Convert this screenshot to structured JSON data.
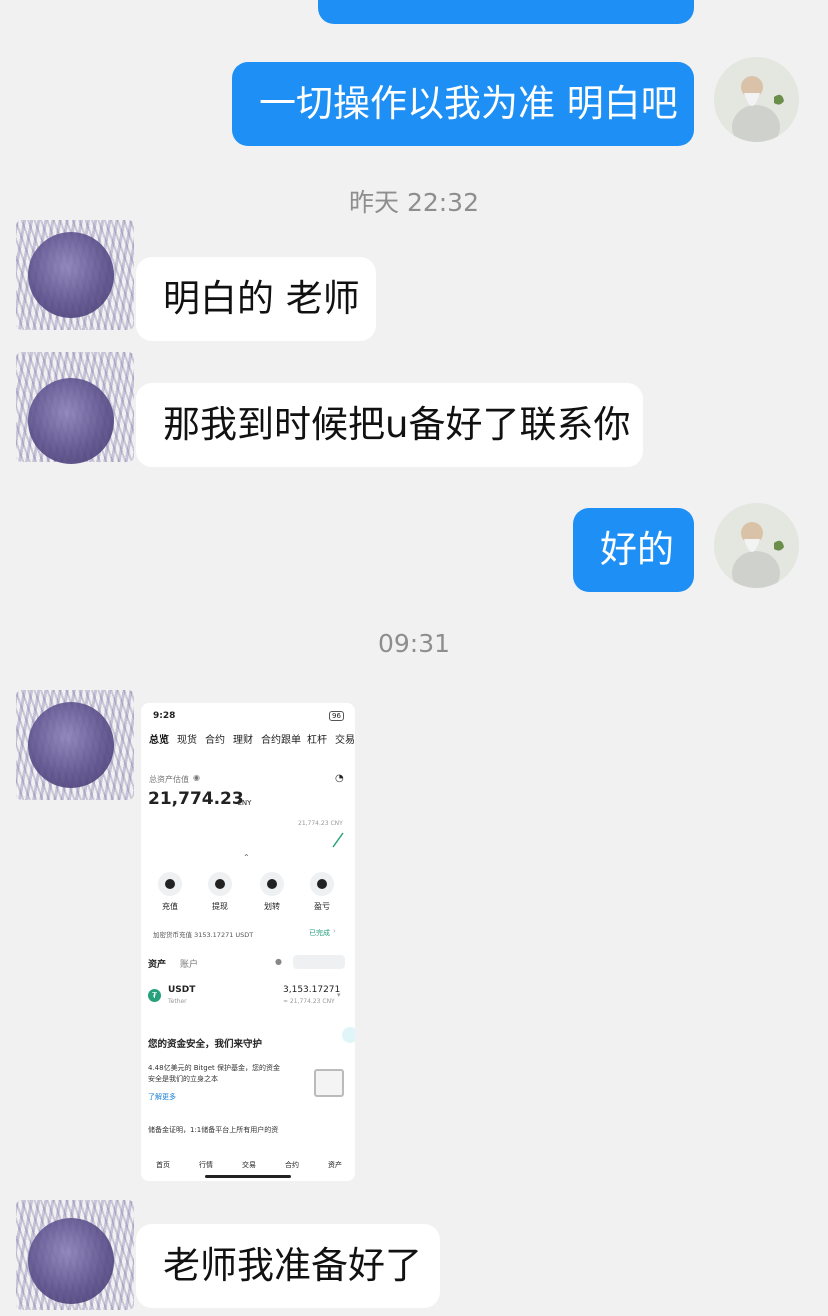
{
  "messages": {
    "m1": "一切操作以我为准 明白吧",
    "ts1": "昨天 22:32",
    "m2": "明白的 老师",
    "m3": "那我到时候把u备好了联系你",
    "m4": "好的",
    "ts2": "09:31",
    "m6": "老师我准备好了"
  },
  "screenshot": {
    "status_time": "9:28",
    "status_right": "96",
    "tabs": [
      "总览",
      "现货",
      "合约",
      "理财",
      "合约跟单",
      "杠杆",
      "交易"
    ],
    "total_label": "总资产估值",
    "total_value": "21,774.23",
    "total_currency": "CNY",
    "sub_value": "21,774.23 CNY",
    "actions": [
      "充值",
      "提现",
      "划转",
      "盈亏"
    ],
    "deposit_note": "加密货币充值 3153.17271 USDT",
    "deposit_status": "已完成",
    "asset_tabs": [
      "资产",
      "账户"
    ],
    "coin_name": "USDT",
    "coin_sub": "Tether",
    "coin_amount": "3,153.17271",
    "coin_cny": "≈ 21,774.23 CNY",
    "security_title": "您的资金安全，我们来守护",
    "security_text_1": "4.48亿美元的 Bitget 保护基金，您的资金",
    "security_text_2": "安全是我们的立身之本",
    "learn_more": "了解更多",
    "reserve_text": "储备金证明，1:1储备平台上所有用户的资",
    "bottom_nav": [
      "首页",
      "行情",
      "交易",
      "合约",
      "资产"
    ]
  },
  "colors": {
    "bubble_me": "#1e90f5",
    "bubble_them": "#ffffff",
    "background": "#f1f1f1",
    "accent_green": "#26a17b"
  }
}
